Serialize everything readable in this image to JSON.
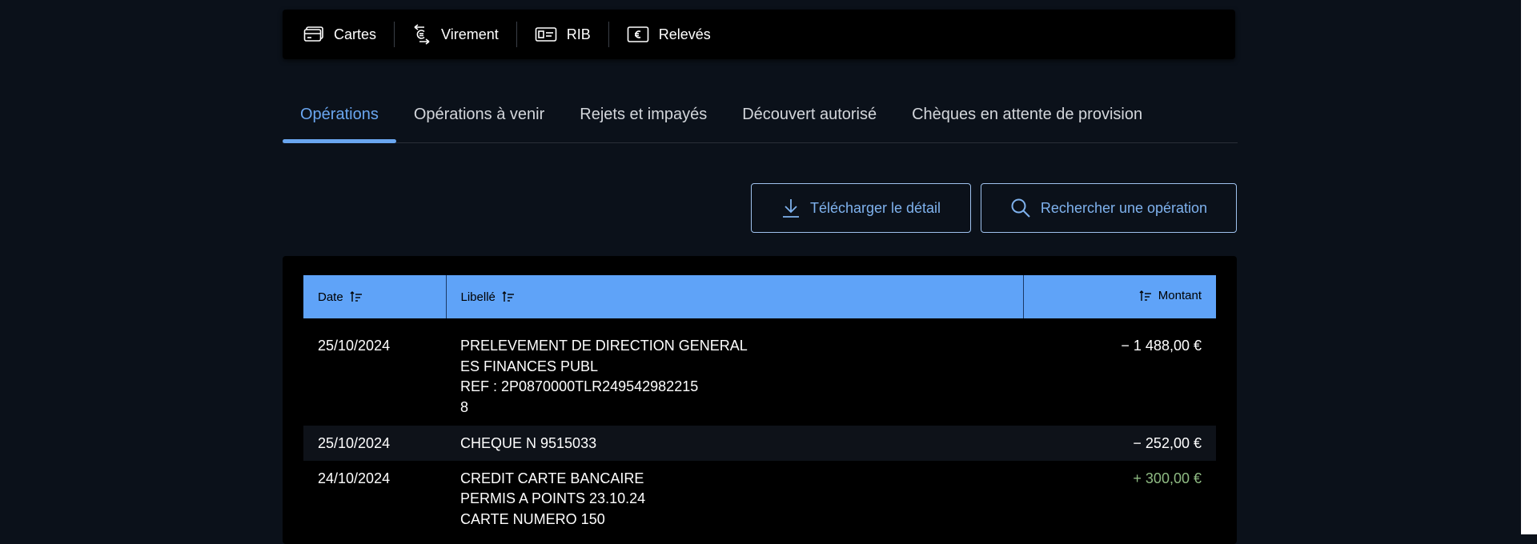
{
  "quick_actions": [
    {
      "label": "Cartes",
      "icon": "card-icon"
    },
    {
      "label": "Virement",
      "icon": "transfer-icon"
    },
    {
      "label": "RIB",
      "icon": "id-card-icon"
    },
    {
      "label": "Relevés",
      "icon": "statement-euro-icon"
    }
  ],
  "tabs": [
    {
      "label": "Opérations",
      "active": true
    },
    {
      "label": "Opérations à venir",
      "active": false
    },
    {
      "label": "Rejets et impayés",
      "active": false
    },
    {
      "label": "Découvert autorisé",
      "active": false
    },
    {
      "label": "Chèques en attente de provision",
      "active": false
    }
  ],
  "actions": {
    "download_label": "Télécharger le détail",
    "search_label": "Rechercher une opération"
  },
  "table": {
    "headers": {
      "date": "Date",
      "label": "Libellé",
      "amount": "Montant"
    },
    "rows": [
      {
        "date": "25/10/2024",
        "lines": [
          "PRELEVEMENT DE DIRECTION GENERAL",
          "ES FINANCES PUBL",
          "REF : 2P0870000TLR249542982215",
          "8"
        ],
        "amount": "− 1 488,00 €",
        "positive": false
      },
      {
        "date": "25/10/2024",
        "lines": [
          "CHEQUE N 9515033"
        ],
        "amount": "− 252,00 €",
        "positive": false
      },
      {
        "date": "24/10/2024",
        "lines": [
          "CREDIT CARTE BANCAIRE",
          "PERMIS A POINTS 23.10.24",
          "CARTE NUMERO 150"
        ],
        "amount": "+ 300,00 €",
        "positive": true
      }
    ]
  },
  "colors": {
    "background": "#0b111a",
    "accent": "#6aa6f0",
    "table_header": "#5fa3f8",
    "positive": "#8fbb83"
  }
}
